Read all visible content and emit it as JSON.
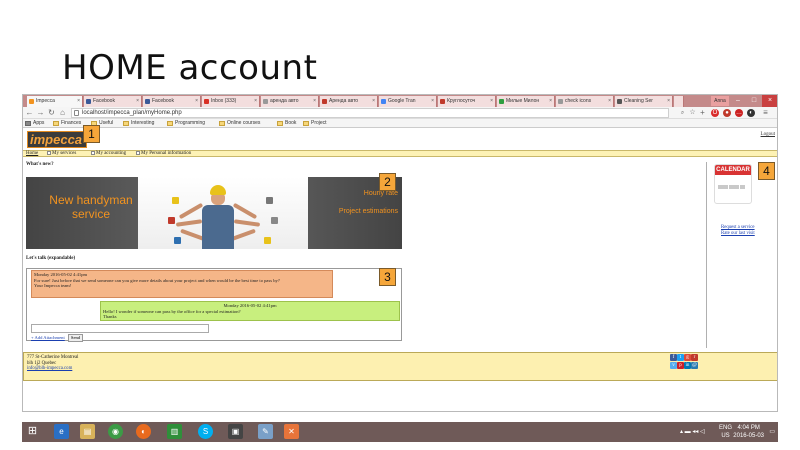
{
  "slide": {
    "title": "HOME account"
  },
  "browser": {
    "tabs": [
      {
        "label": "Impecca",
        "color": "#f2931f"
      },
      {
        "label": "Facebook",
        "color": "#3b5998"
      },
      {
        "label": "Facebook",
        "color": "#3b5998"
      },
      {
        "label": "Inbox (333)",
        "color": "#d93025"
      },
      {
        "label": "аренда авто",
        "color": "#777777"
      },
      {
        "label": "Аренда авто",
        "color": "#c0392b"
      },
      {
        "label": "Google Tran",
        "color": "#4285f4"
      },
      {
        "label": "Круглосуточ",
        "color": "#c0392b"
      },
      {
        "label": "Милые Милон",
        "color": "#2e9e3f"
      },
      {
        "label": "check icons",
        "color": "#777777"
      },
      {
        "label": "Cleaning Ser",
        "color": "#555555"
      }
    ],
    "user_badge": "Anna",
    "address": "localhost/impecca_plan/myHome.php",
    "bookmarks": [
      "Apps",
      "Finances",
      "Useful",
      "Interesting",
      "Programming",
      "Online courses",
      "Book",
      "Project"
    ]
  },
  "page": {
    "logo": "impecca",
    "logout": "Logout",
    "menu": [
      "Home",
      "My services",
      "My accounting",
      "My Personal information"
    ],
    "whats_new": "What's new?",
    "banner": {
      "left_line1": "New handyman",
      "left_line2": "service",
      "right_line1": "Hourly rate",
      "right_line2": "Project estimations"
    },
    "lets_talk": "Let's talk (expandable)",
    "messages": [
      {
        "timestamp": "Monday 2016-05-02 4:41pm",
        "text": "For sure! Just before that we send someone can you give more details about your project and when would be the best time to pass by?",
        "signature": "Your Impecca team!"
      },
      {
        "timestamp": "Monday 2016-05-02 4:41pm",
        "text": "Hello! I wonder if someone can pass by the office for a special estimation?",
        "signature": "Thanks"
      }
    ],
    "add_attachment": "+ Add Attachment",
    "send_label": "Send",
    "calendar_label": "CALENDAR",
    "side_links": [
      "Request a service",
      "Rate our last visit"
    ],
    "footer": {
      "line1": "777 St-Catherine Montreal",
      "line2": "blh 1j2 Quebec",
      "email": "info@blh-impecca.com"
    }
  },
  "callouts": [
    "1",
    "2",
    "3",
    "4"
  ],
  "taskbar": {
    "lang": "ENG",
    "region": "US",
    "time": "4:04 PM",
    "date": "2016-05-03"
  },
  "colors": {
    "accent_orange": "#f2931f",
    "menu_bg": "#fdf2b5",
    "callout": "#f5a63a",
    "msg_user": "#f5b688",
    "msg_reply": "#c8ef7e"
  }
}
